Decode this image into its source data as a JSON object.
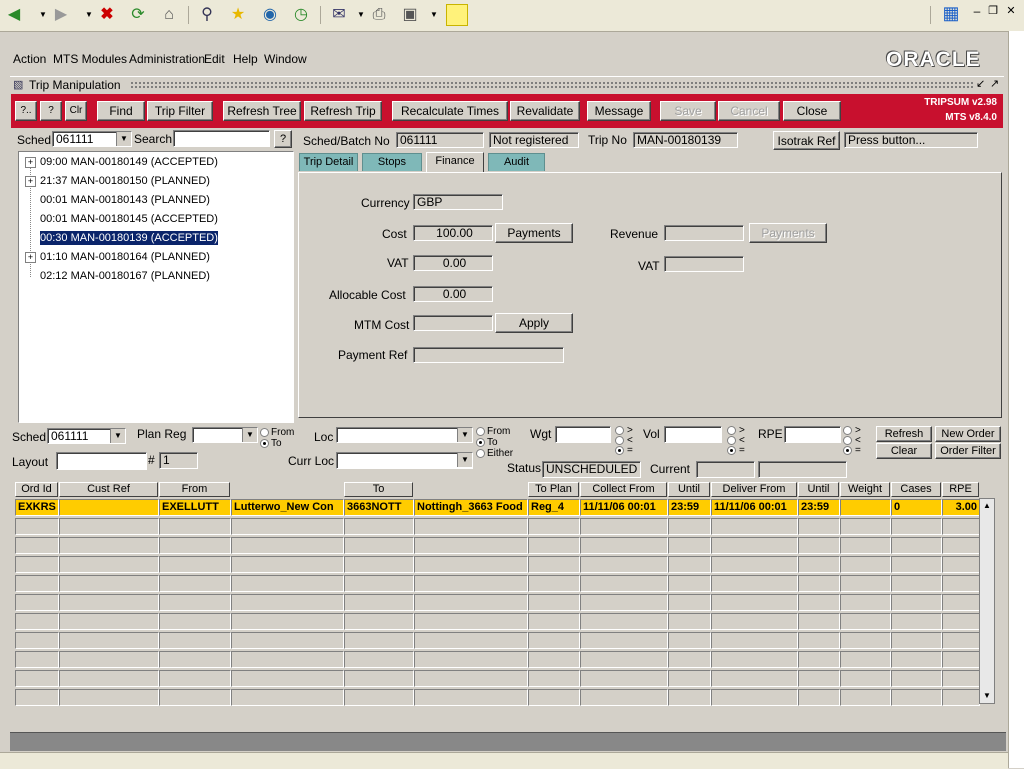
{
  "menu": {
    "items": [
      "Action",
      "MTS Modules",
      "Administration",
      "Edit",
      "Help",
      "Window"
    ],
    "logo": "ORACLE"
  },
  "window": {
    "title": "Trip Manipulation"
  },
  "toolbar": {
    "b_prev": "?..",
    "b_help": "?",
    "b_clr": "Clr",
    "find": "Find",
    "trip_filter": "Trip Filter",
    "refresh_tree": "Refresh Tree",
    "refresh_trip": "Refresh Trip",
    "recalc": "Recalculate Times",
    "revalidate": "Revalidate",
    "message": "Message",
    "save": "Save",
    "cancel": "Cancel",
    "close": "Close",
    "version1": "TRIPSUM v2.98",
    "version2": "MTS v8.4.0"
  },
  "left": {
    "sched_label": "Sched",
    "sched_value": "061111",
    "search_label": "Search",
    "search_value": "",
    "search_btn": "?",
    "tree": [
      {
        "text": "09:00 MAN-00180149 (ACCEPTED)",
        "expand": "+"
      },
      {
        "text": "21:37 MAN-00180150 (PLANNED)",
        "expand": "+"
      },
      {
        "text": "00:01 MAN-00180143 (PLANNED)",
        "expand": ""
      },
      {
        "text": "00:01 MAN-00180145 (ACCEPTED)",
        "expand": ""
      },
      {
        "text": "00:30 MAN-00180139 (ACCEPTED)",
        "expand": ""
      },
      {
        "text": "01:10 MAN-00180164 (PLANNED)",
        "expand": "+"
      },
      {
        "text": "02:12 MAN-00180167 (PLANNED)",
        "expand": ""
      }
    ]
  },
  "header": {
    "sched_batch_label": "Sched/Batch No",
    "sched_batch_value": "061111",
    "reg_status": "Not registered",
    "trip_no_label": "Trip No",
    "trip_no_value": "MAN-00180139",
    "isotrak_btn": "Isotrak Ref",
    "isotrak_value": "Press button..."
  },
  "tabs": [
    "Trip Detail",
    "Stops",
    "Finance",
    "Audit"
  ],
  "finance": {
    "currency_label": "Currency",
    "currency_value": "GBP",
    "cost_label": "Cost",
    "cost_value": "100.00",
    "payments_btn": "Payments",
    "revenue_label": "Revenue",
    "revenue_value": "",
    "payments_btn2": "Payments",
    "vat_label": "VAT",
    "vat_value": "0.00",
    "vat2_label": "VAT",
    "vat2_value": "",
    "alloc_label": "Allocable Cost",
    "alloc_value": "0.00",
    "mtm_label": "MTM Cost",
    "mtm_value": "",
    "apply_btn": "Apply",
    "payref_label": "Payment Ref",
    "payref_value": ""
  },
  "filters": {
    "sched_label": "Sched",
    "sched_value": "061111",
    "planreg_label": "Plan Reg",
    "planreg_value": "",
    "from": "From",
    "to": "To",
    "either": "Either",
    "loc_label": "Loc",
    "loc_value": "",
    "wgt_label": "Wgt",
    "wgt_value": "",
    "vol_label": "Vol",
    "vol_value": "",
    "rpe_label": "RPE",
    "rpe_value": "",
    "gt": ">",
    "lt": "<",
    "eq": "=",
    "refresh": "Refresh",
    "new_order": "New Order",
    "clear": "Clear",
    "order_filter": "Order Filter",
    "layout_label": "Layout",
    "layout_value": "",
    "hash_label": "#",
    "hash_value": "1",
    "currloc_label": "Curr Loc",
    "currloc_value": "",
    "status_label": "Status",
    "status_value": "UNSCHEDULED",
    "current_label": "Current",
    "current_value": ""
  },
  "grid": {
    "headers": {
      "ord_id": "Ord Id",
      "cust_ref": "Cust Ref",
      "from": "From",
      "to": "To",
      "to_plan": "To Plan",
      "collect_from": "Collect From",
      "until1": "Until",
      "deliver_from": "Deliver From",
      "until2": "Until",
      "weight": "Weight",
      "cases": "Cases",
      "rpe": "RPE"
    },
    "row": [
      "EXKRS",
      "",
      "EXELLUTT",
      "Lutterwo_New Con",
      "3663NOTT",
      "Nottingh_3663 Food",
      "Reg_4",
      "11/11/06 00:01",
      "23:59",
      "11/11/06 00:01",
      "23:59",
      "",
      "0",
      "3.00"
    ],
    "empty_rows": 10
  }
}
